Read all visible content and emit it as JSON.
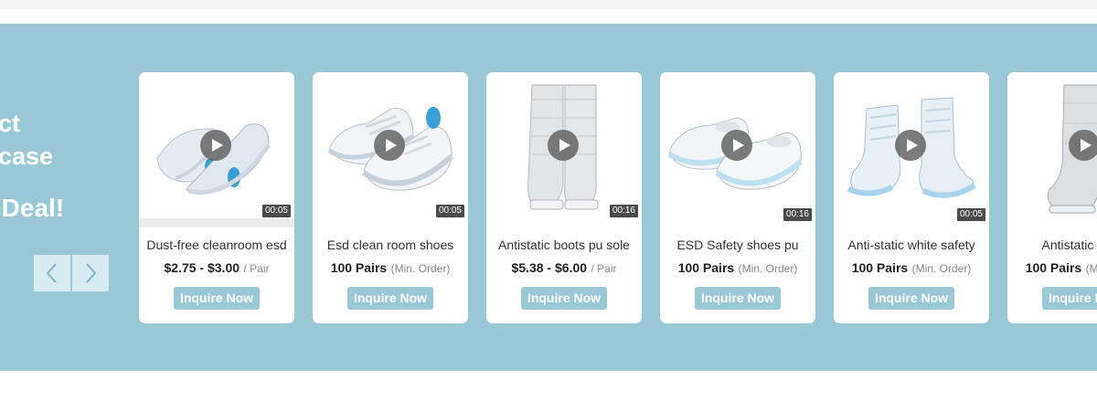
{
  "showcase": {
    "intro_lines": [
      "ct",
      "case",
      "r Deal!"
    ],
    "nav": {
      "prev_icon": "chevron-left-icon",
      "next_icon": "chevron-right-icon"
    },
    "products": [
      {
        "title": "Dust-free cleanroom esd",
        "price": "$2.75 - $3.00",
        "unit": "/ Pair",
        "duration": "00:05",
        "button": "Inquire Now",
        "image": "white-esd-sandal-shoes"
      },
      {
        "title": "Esd clean room shoes",
        "price": "100 Pairs",
        "unit": "(Min. Order)",
        "duration": "00:05",
        "button": "Inquire Now",
        "image": "white-lace-up-shoes"
      },
      {
        "title": "Antistatic boots pu sole",
        "price": "$5.38 - $6.00",
        "unit": "/ Pair",
        "duration": "00:16",
        "button": "Inquire Now",
        "image": "grey-tall-cleanroom-boots"
      },
      {
        "title": "ESD Safety shoes pu",
        "price": "100 Pairs",
        "unit": "(Min. Order)",
        "duration": "00:16",
        "button": "Inquire Now",
        "image": "white-slip-on-shoes"
      },
      {
        "title": "Anti-static white safety",
        "price": "100 Pairs",
        "unit": "(Min. Order)",
        "duration": "00:05",
        "button": "Inquire Now",
        "image": "white-ankle-boots"
      },
      {
        "title": "Antistatic boots",
        "price": "100 Pairs",
        "unit": "(Min. Order)",
        "duration": "",
        "button": "Inquire Now",
        "image": "grey-tall-boot"
      }
    ]
  },
  "colors": {
    "band": "#9ac8d5",
    "card": "#ffffff",
    "button": "#9ac8d5",
    "nav_button": "#d7ebf1"
  }
}
